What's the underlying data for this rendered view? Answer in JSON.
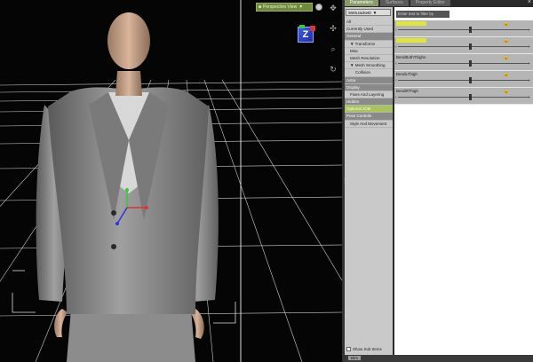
{
  "viewport": {
    "camera_label": "Perspective View",
    "axis_label": "Z"
  },
  "panel": {
    "tabs": [
      {
        "label": "Parameters",
        "active": true
      },
      {
        "label": "Surfaces",
        "active": false
      },
      {
        "label": "Property Editor",
        "active": false
      }
    ],
    "node_select_value": "SWSJacket0",
    "filter_placeholder": "Enter text to filter by",
    "tree": [
      {
        "label": "All",
        "kind": "item"
      },
      {
        "label": "Currently Used",
        "kind": "item"
      },
      {
        "label": "General",
        "kind": "header"
      },
      {
        "label": "▼ Transforms",
        "kind": "item"
      },
      {
        "label": "Misc",
        "kind": "item"
      },
      {
        "label": "Mesh Resolution",
        "kind": "item"
      },
      {
        "label": "▼ Mesh Smoothing",
        "kind": "item"
      },
      {
        "label": "Collision",
        "kind": "item"
      },
      {
        "label": "Actor",
        "kind": "header"
      },
      {
        "label": "Display",
        "kind": "header"
      },
      {
        "label": "Fixes And Layering",
        "kind": "item"
      },
      {
        "label": "Hidden",
        "kind": "header"
      },
      {
        "label": "Optional JCM",
        "kind": "highlight"
      },
      {
        "label": "Pose Controls",
        "kind": "header"
      },
      {
        "label": "Style And Movement",
        "kind": "item"
      }
    ],
    "show_sub_items_label": "Show Sub Items",
    "parameters": [
      {
        "label": "",
        "value": 0.55
      },
      {
        "label": "",
        "value": 0.55
      },
      {
        "label": "BendBothThighs",
        "value": 0.55
      },
      {
        "label": "BendLThigh",
        "value": 0.55
      },
      {
        "label": "BendRThigh",
        "value": 0.55
      }
    ],
    "status_tab_label": "Dim"
  },
  "colors": {
    "accent": "#a8c45a",
    "viewport_bg": "#050505"
  }
}
